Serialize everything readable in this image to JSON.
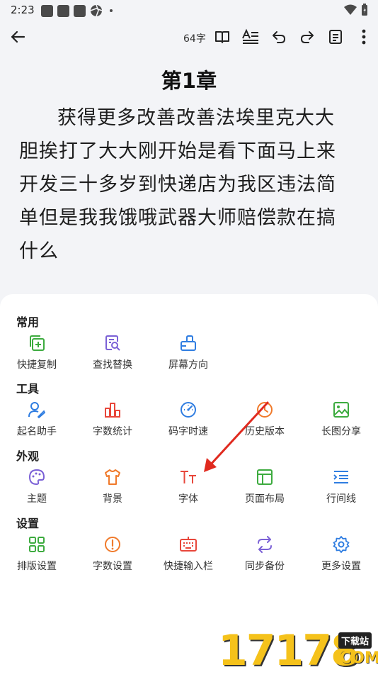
{
  "status_bar": {
    "time": "2:23"
  },
  "toolbar": {
    "word_count": "64字"
  },
  "document": {
    "title": "第1章",
    "body": "获得更多改善改善法埃里克大大胆挨打了大大刚开始是看下面马上来开发三十多岁到快递店为我区违法简单但是我我饿哦武器大师赔偿款在搞什么"
  },
  "sheet": {
    "sections": [
      {
        "title": "常用",
        "items": [
          {
            "label": "快捷复制",
            "icon": "copy-add-icon",
            "color": "#3dab3f"
          },
          {
            "label": "查找替换",
            "icon": "find-replace-icon",
            "color": "#7b61d6"
          },
          {
            "label": "屏幕方向",
            "icon": "screen-rotate-icon",
            "color": "#2f7de1"
          }
        ]
      },
      {
        "title": "工具",
        "items": [
          {
            "label": "起名助手",
            "icon": "user-edit-icon",
            "color": "#2f7de1"
          },
          {
            "label": "字数统计",
            "icon": "bar-chart-icon",
            "color": "#e8473b"
          },
          {
            "label": "码字时速",
            "icon": "speedometer-icon",
            "color": "#2f7de1"
          },
          {
            "label": "历史版本",
            "icon": "history-icon",
            "color": "#f07a2b"
          },
          {
            "label": "长图分享",
            "icon": "image-share-icon",
            "color": "#3dab3f"
          }
        ]
      },
      {
        "title": "外观",
        "items": [
          {
            "label": "主题",
            "icon": "palette-icon",
            "color": "#7b61d6"
          },
          {
            "label": "背景",
            "icon": "shirt-icon",
            "color": "#f07a2b"
          },
          {
            "label": "字体",
            "icon": "font-icon",
            "color": "#e8473b"
          },
          {
            "label": "页面布局",
            "icon": "layout-icon",
            "color": "#3dab3f"
          },
          {
            "label": "行间线",
            "icon": "line-spacing-icon",
            "color": "#2f7de1"
          }
        ]
      },
      {
        "title": "设置",
        "items": [
          {
            "label": "排版设置",
            "icon": "grid-layout-icon",
            "color": "#3dab3f"
          },
          {
            "label": "字数设置",
            "icon": "alert-circle-icon",
            "color": "#f07a2b"
          },
          {
            "label": "快捷输入栏",
            "icon": "keyboard-icon",
            "color": "#e8473b"
          },
          {
            "label": "同步备份",
            "icon": "sync-icon",
            "color": "#7b61d6"
          },
          {
            "label": "更多设置",
            "icon": "gear-icon",
            "color": "#2f7de1"
          }
        ]
      }
    ]
  },
  "watermark": {
    "number": "17178",
    "badge": "下载站",
    "domain": "COM"
  }
}
